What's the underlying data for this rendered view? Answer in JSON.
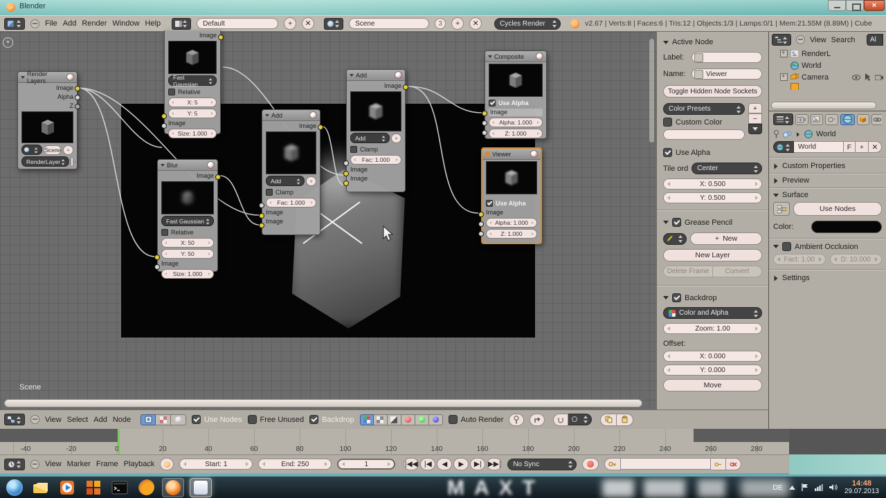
{
  "colors": {
    "accent_orange": "#d98a2b",
    "toggle_blue": "#6f9ad1",
    "socket_yellow": "#e4cf3a",
    "playhead_green": "#62d83a",
    "record_red": "#cf3a2a"
  },
  "window": {
    "title": "Blender"
  },
  "topbar": {
    "menus": [
      "File",
      "Add",
      "Render",
      "Window",
      "Help"
    ],
    "layout": "Default",
    "scene": "Scene",
    "scene_users": "3",
    "engine": "Cycles Render",
    "stats": "v2.67 | Verts:8 | Faces:6 | Tris:12 | Objects:1/3 | Lamps:0/1 | Mem:21.55M (8.89M) | Cube"
  },
  "nodes": {
    "render_layers": {
      "title": "Render Layers",
      "out_image": "Image",
      "out_alpha": "Alpha",
      "out_z": "Z",
      "scene": "Scene",
      "layer": "RenderLayer"
    },
    "blur_top": {
      "out": "Image",
      "filter": "Fast Gaussian",
      "relative": "Relative",
      "x": "X: 5",
      "y": "Y: 5",
      "in_image": "Image",
      "size": "Size: 1.000"
    },
    "blur_left": {
      "title": "Blur",
      "out": "Image",
      "filter": "Fast Gaussian",
      "relative": "Relative",
      "x": "X: 50",
      "y": "Y: 50",
      "in_image": "Image",
      "size": "Size: 1.000"
    },
    "add_mid": {
      "title": "Add",
      "out": "Image",
      "mode": "Add",
      "clamp": "Clamp",
      "fac": "Fac: 1.000",
      "in1": "Image",
      "in2": "Image"
    },
    "add_right": {
      "title": "Add",
      "out": "Image",
      "mode": "Add",
      "clamp": "Clamp",
      "fac": "Fac: 1.000",
      "in1": "Image",
      "in2": "Image"
    },
    "composite": {
      "title": "Composite",
      "use_alpha": "Use Alpha",
      "in_image": "Image",
      "alpha": "Alpha: 1.000",
      "z": "Z: 1.000"
    },
    "viewer": {
      "title": "Viewer",
      "use_alpha": "Use Alpha",
      "in_image": "Image",
      "alpha": "Alpha: 1.000",
      "z": "Z: 1.000"
    }
  },
  "editor": {
    "scene_label": "Scene"
  },
  "node_header": {
    "menus": [
      "View",
      "Select",
      "Add",
      "Node"
    ],
    "use_nodes": "Use Nodes",
    "free_unused": "Free Unused",
    "backdrop": "Backdrop",
    "auto_render": "Auto Render"
  },
  "npanel": {
    "active_node": "Active Node",
    "label": "Label:",
    "name": "Name:",
    "name_value": "Viewer",
    "toggle_sockets": "Toggle Hidden Node Sockets",
    "color_presets": "Color Presets",
    "custom_color": "Custom Color",
    "use_alpha": "Use Alpha",
    "tile_order_label": "Tile ord",
    "tile_order": "Center",
    "x": "X: 0.500",
    "y": "Y: 0.500",
    "grease_pencil": "Grease Pencil",
    "new": "New",
    "new_layer": "New Layer",
    "delete_frame": "Delete Frame",
    "convert": "Convert",
    "backdrop": "Backdrop",
    "backdrop_mode": "Color and Alpha",
    "zoom": "Zoom: 1.00",
    "offset": "Offset:",
    "off_x": "X: 0.000",
    "off_y": "Y: 0.000",
    "move": "Move"
  },
  "outliner": {
    "menus": [
      "View",
      "Search"
    ],
    "filter": "Al",
    "items": [
      "RenderL",
      "World",
      "Camera"
    ]
  },
  "properties": {
    "breadcrumb": "World",
    "datablock": "World",
    "fake_user": "F",
    "custom_properties": "Custom Properties",
    "preview": "Preview",
    "surface": "Surface",
    "use_nodes": "Use Nodes",
    "color_label": "Color:",
    "ambient_occlusion": "Ambient Occlusion",
    "factor": "Fact: 1.00",
    "distance": "D: 10.000",
    "settings": "Settings"
  },
  "timeline": {
    "ticks": [
      "-40",
      "-20",
      "0",
      "20",
      "40",
      "60",
      "80",
      "100",
      "120",
      "140",
      "160",
      "180",
      "200",
      "220",
      "240",
      "260",
      "280"
    ],
    "menus": [
      "View",
      "Marker",
      "Frame",
      "Playback"
    ],
    "start": "Start: 1",
    "end": "End: 250",
    "frame": "1",
    "sync": "No Sync"
  },
  "taskbar": {
    "watermark": "MAXT",
    "tray_lang": "DE",
    "time": "14:48",
    "date": "29.07.2013"
  }
}
